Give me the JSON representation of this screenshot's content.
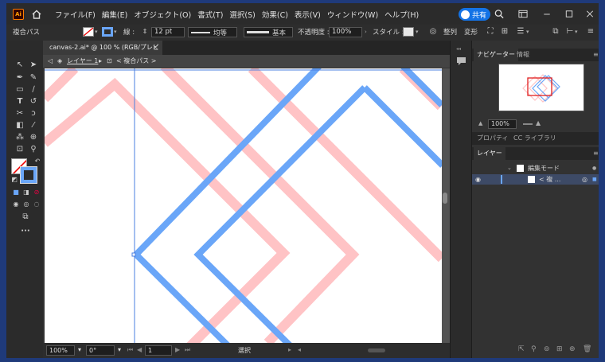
{
  "taskbar_color": "#1f3a7a",
  "accent_color": "#1473e6",
  "app": {
    "logo": "Ai",
    "menus": [
      "ファイル(F)",
      "編集(E)",
      "オブジェクト(O)",
      "書式(T)",
      "選択(S)",
      "効果(C)",
      "表示(V)",
      "ウィンドウ(W)",
      "ヘルプ(H)"
    ],
    "share_label": "共有",
    "window_controls": [
      "minimize-icon",
      "maximize-icon",
      "close-icon"
    ]
  },
  "control_bar": {
    "selection_type": "複合パス",
    "stroke_label": "線 :",
    "stroke_weight": "12 pt",
    "profile_label": "均等",
    "brush_label": "基本",
    "opacity_label": "不透明度 :",
    "opacity_value": "100%",
    "style_label": "スタイル :",
    "align_label": "整列",
    "transform_label": "変形"
  },
  "document": {
    "tab_title": "canvas-2.ai* @ 100 % (RGB/プレビュー)",
    "breadcrumb_layer": "レイヤー 1",
    "breadcrumb_object": "< 複合パス >"
  },
  "status_bar": {
    "zoom": "100%",
    "rotation": "0°",
    "artboard": "1",
    "tool_status": "選択"
  },
  "panels": {
    "navigator_tab": "ナビゲーター",
    "info_tab": "情報",
    "nav_zoom": "100%",
    "properties_tab": "プロパティ",
    "libraries_tab": "CC ライブラリ",
    "layers_tab": "レイヤー",
    "layers": [
      {
        "label": "編集モード",
        "selected": false
      },
      {
        "label": "< 複 ...",
        "selected": true
      }
    ]
  },
  "artwork_colors": {
    "pink": "#ffc3c5",
    "blue": "#6aa6f8"
  }
}
